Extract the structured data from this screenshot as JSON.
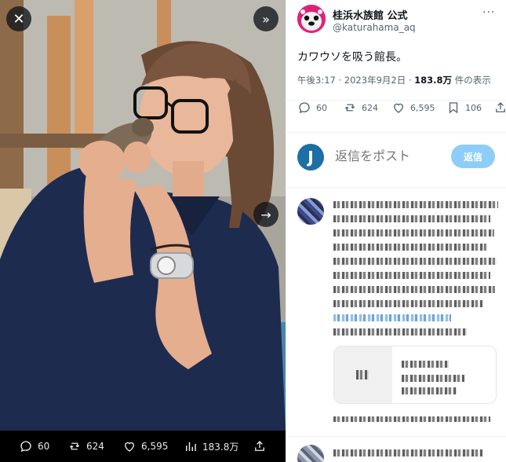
{
  "viewer": {
    "close_icon": "close-icon",
    "collapse_icon": "double-chevron-right-icon",
    "next_icon": "arrow-right-icon",
    "actions": {
      "replies": "60",
      "reposts": "624",
      "likes": "6,595",
      "views": "183.8万"
    }
  },
  "tweet": {
    "display_name": "桂浜水族館 公式",
    "handle": "@katurahama_aq",
    "more_icon": "more-icon",
    "text": "カワウソを吸う館長。",
    "time": "午後3:17",
    "sep1": " · ",
    "date": "2023年9月2日",
    "sep2": " · ",
    "views": "183.8万",
    "views_label": " 件の表示",
    "stats": {
      "replies": "60",
      "reposts": "624",
      "likes": "6,595",
      "bookmarks": "106"
    }
  },
  "reply_box": {
    "avatar_letter": "J",
    "placeholder": "返信をポスト",
    "button": "返信"
  },
  "colors": {
    "accent": "#1d9bf0",
    "reply_button": "#8ecdf8",
    "brand_avatar": "#e0217a"
  }
}
